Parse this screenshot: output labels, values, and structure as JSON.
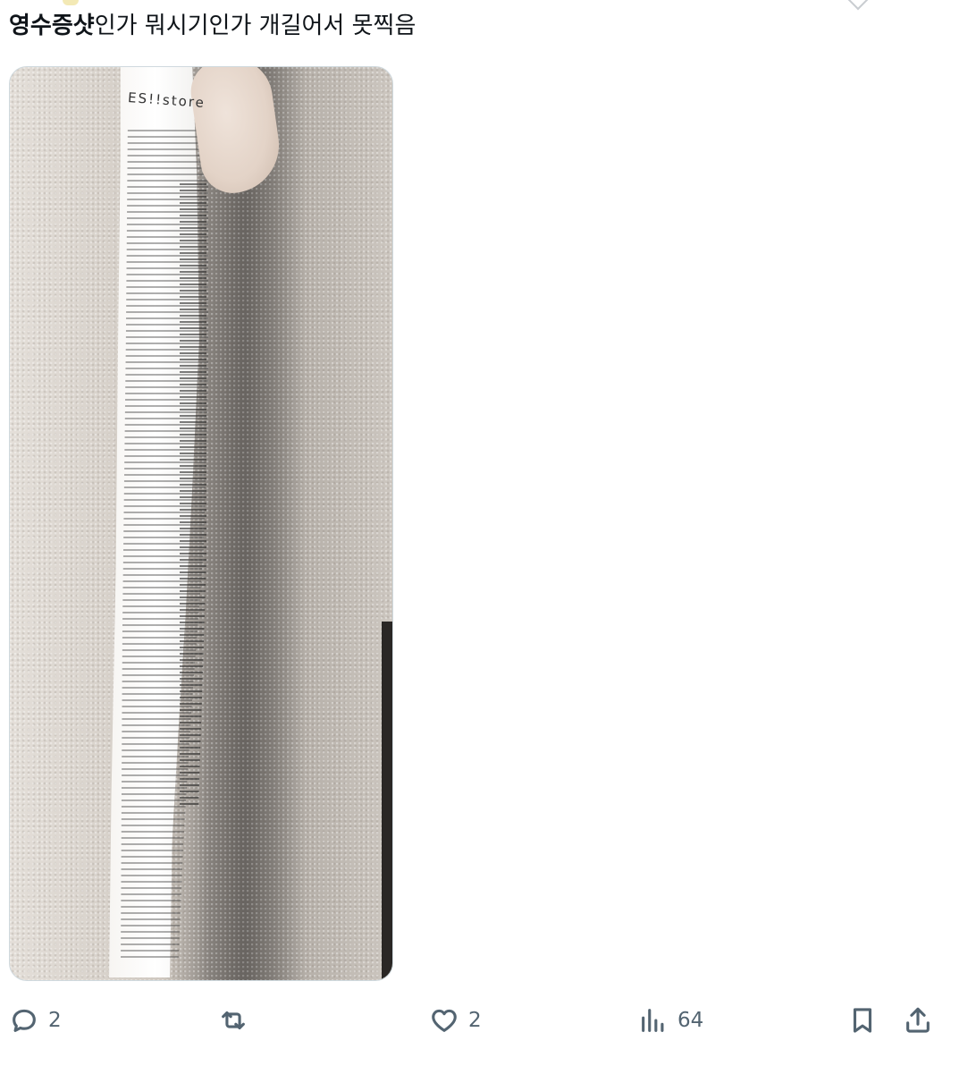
{
  "tweet": {
    "bold_text": "영수증샷",
    "text": "인가 뭐시기인가 개길어서 못찍음"
  },
  "media": {
    "receipt_brand": "ES!!store"
  },
  "actions": {
    "reply_count": "2",
    "retweet_count": "",
    "like_count": "2",
    "view_count": "64"
  },
  "icons": {
    "reply": "reply-icon",
    "retweet": "retweet-icon",
    "like": "heart-icon",
    "views": "views-icon",
    "bookmark": "bookmark-icon",
    "share": "share-icon"
  },
  "colors": {
    "text": "#0f1419",
    "muted": "#536471",
    "border": "#cfd9de"
  }
}
